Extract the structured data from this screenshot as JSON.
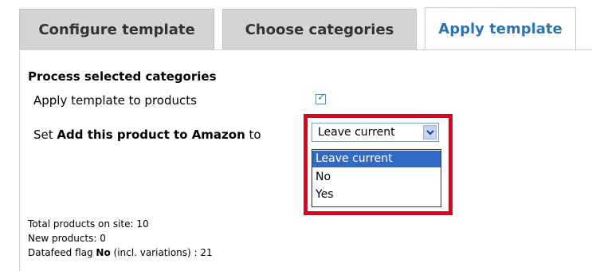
{
  "tabs": [
    {
      "label": "Configure template",
      "active": false
    },
    {
      "label": "Choose categories",
      "active": false
    },
    {
      "label": "Apply template",
      "active": true
    }
  ],
  "section": {
    "title": "Process selected categories"
  },
  "apply": {
    "label": "Apply template to products",
    "checked": true
  },
  "set": {
    "prefix": "Set ",
    "field": "Add this product to Amazon",
    "suffix": " to",
    "selected": "Leave current",
    "options": [
      "Leave current",
      "No",
      "Yes"
    ]
  },
  "stats": {
    "total": "Total products on site: 10",
    "new": "New products: 0",
    "flag_prefix": "Datafeed flag ",
    "flag_value": "No",
    "flag_suffix": " (incl. variations) : 21"
  },
  "colors": {
    "accent": "#2b74b0",
    "highlight": "#e3001b",
    "selected_option": "#3169c6"
  }
}
